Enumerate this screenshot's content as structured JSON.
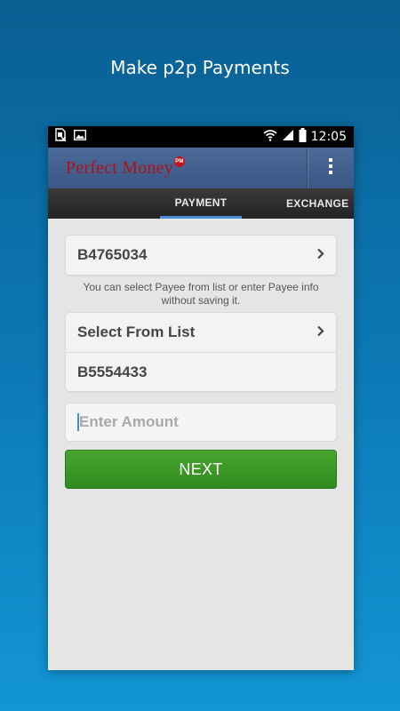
{
  "headline": "Make p2p Payments",
  "status_bar": {
    "time": "12:05",
    "icons": [
      "sim-off-icon",
      "image-icon",
      "wifi-icon",
      "signal-icon",
      "battery-icon"
    ]
  },
  "app_bar": {
    "logo_text": "Perfect Money",
    "logo_badge": "PM",
    "menu_icon": "overflow-menu-icon"
  },
  "tabs": [
    {
      "label": "PAYMENT",
      "active": true
    },
    {
      "label": "EXCHANGE",
      "active": false
    }
  ],
  "form": {
    "payer_account": "B4765034",
    "hint": "You can select Payee from list or enter Payee info without saving it.",
    "select_from_list_label": "Select From List",
    "payee_account": "B5554433",
    "amount_placeholder": "Enter Amount",
    "amount_value": "",
    "next_label": "NEXT"
  },
  "colors": {
    "background_top": "#0a5f92",
    "background_bottom": "#1396d3",
    "app_bar": "#3a5786",
    "logo_red": "#b0101a",
    "next_green": "#3a9626",
    "tab_indicator": "#4a90d9"
  }
}
